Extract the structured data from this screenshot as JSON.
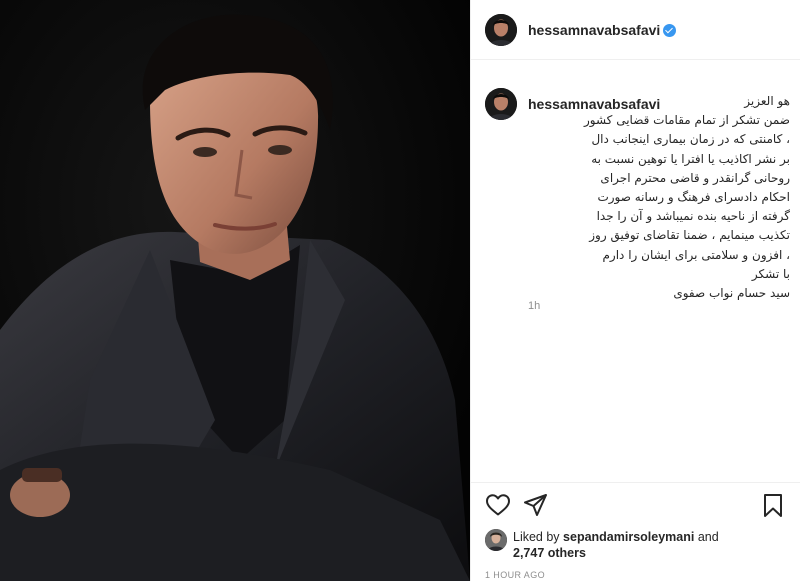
{
  "post": {
    "username": "hessamnavabsafavi",
    "verified": true,
    "photo_alt": "Portrait of man in dark suit against black background"
  },
  "caption": {
    "username": "hessamnavabsafavi",
    "lines": [
      "هو العزیز",
      "ضمن تشکر از تمام مقامات قضایی کشور",
      "، کامنتی که در زمان بیماری اینجانب دال",
      "بر نشر اکاذیب یا افترا یا توهین نسبت به",
      "روحانی گرانقدر و قاضی محترم اجرای",
      "احکام دادسرای فرهنگ و رسانه صورت",
      "گرفته از ناحیه بنده نمیباشد و آن را جدا",
      "تکذیب مینمایم ، ضمنا تقاضای توفیق روز",
      "، افزون و سلامتی برای ایشان را دارم",
      "با تشکر",
      "سید حسام نواب صفوی"
    ],
    "time_ago": "1h"
  },
  "actions": {
    "like": "heart-icon",
    "share": "share-icon",
    "save": "bookmark-icon"
  },
  "likes": {
    "prefix": "Liked by",
    "user": "sepandamirsoleymani",
    "joiner": "and",
    "others": "2,747 others"
  },
  "timestamp": "1 HOUR AGO",
  "colors": {
    "verified": "#3897f0",
    "muted": "#8e8e8e",
    "text": "#262626"
  }
}
